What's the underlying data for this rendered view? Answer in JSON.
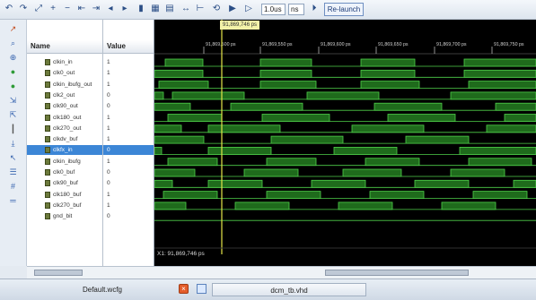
{
  "toolbar": {
    "run_time_value": "1.0us",
    "run_time_unit": "ns",
    "relaunch_label": "Re-launch"
  },
  "columns": {
    "name": "Name",
    "value": "Value"
  },
  "signals": [
    {
      "name": "clkin_in",
      "value": "1",
      "wave": "mixed"
    },
    {
      "name": "clk0_out",
      "value": "1",
      "wave": "mixed"
    },
    {
      "name": "clkin_ibufg_out",
      "value": "1",
      "wave": "mixed"
    },
    {
      "name": "clk2_out",
      "value": "0",
      "wave": "mixed"
    },
    {
      "name": "clk90_out",
      "value": "0",
      "wave": "mixed"
    },
    {
      "name": "clk180_out",
      "value": "1",
      "wave": "mixed"
    },
    {
      "name": "clk270_out",
      "value": "1",
      "wave": "mixed"
    },
    {
      "name": "clkdv_buf",
      "value": "1",
      "wave": "mixed"
    },
    {
      "name": "clkfx_in",
      "value": "0",
      "wave": "mixed",
      "selected": true
    },
    {
      "name": "clkin_ibufg",
      "value": "1",
      "wave": "mixed"
    },
    {
      "name": "clk0_buf",
      "value": "0",
      "wave": "mixed"
    },
    {
      "name": "clk90_buf",
      "value": "0",
      "wave": "mixed"
    },
    {
      "name": "clk180_buf",
      "value": "1",
      "wave": "mixed"
    },
    {
      "name": "clk270_buf",
      "value": "1",
      "wave": "mixed"
    },
    {
      "name": "gnd_bit",
      "value": "0",
      "wave": "low"
    }
  ],
  "timeline": {
    "cursor_label": "91,869,746 ps",
    "ticks": [
      "91,869,500 ps",
      "91,869,550 ps",
      "91,869,600 ps",
      "91,869,650 ps",
      "91,869,700 ps",
      "91,869,750 ps"
    ],
    "readout": "X1: 91,869,746 ps"
  },
  "tabs": {
    "default_label": "Default.wcfg",
    "file_label": "dcm_tb.vhd"
  },
  "colors": {
    "wave_fill": "#1f6b1c",
    "wave_line": "#4fd04a",
    "cursor": "#e6e64a",
    "selection": "#3c86d6"
  }
}
